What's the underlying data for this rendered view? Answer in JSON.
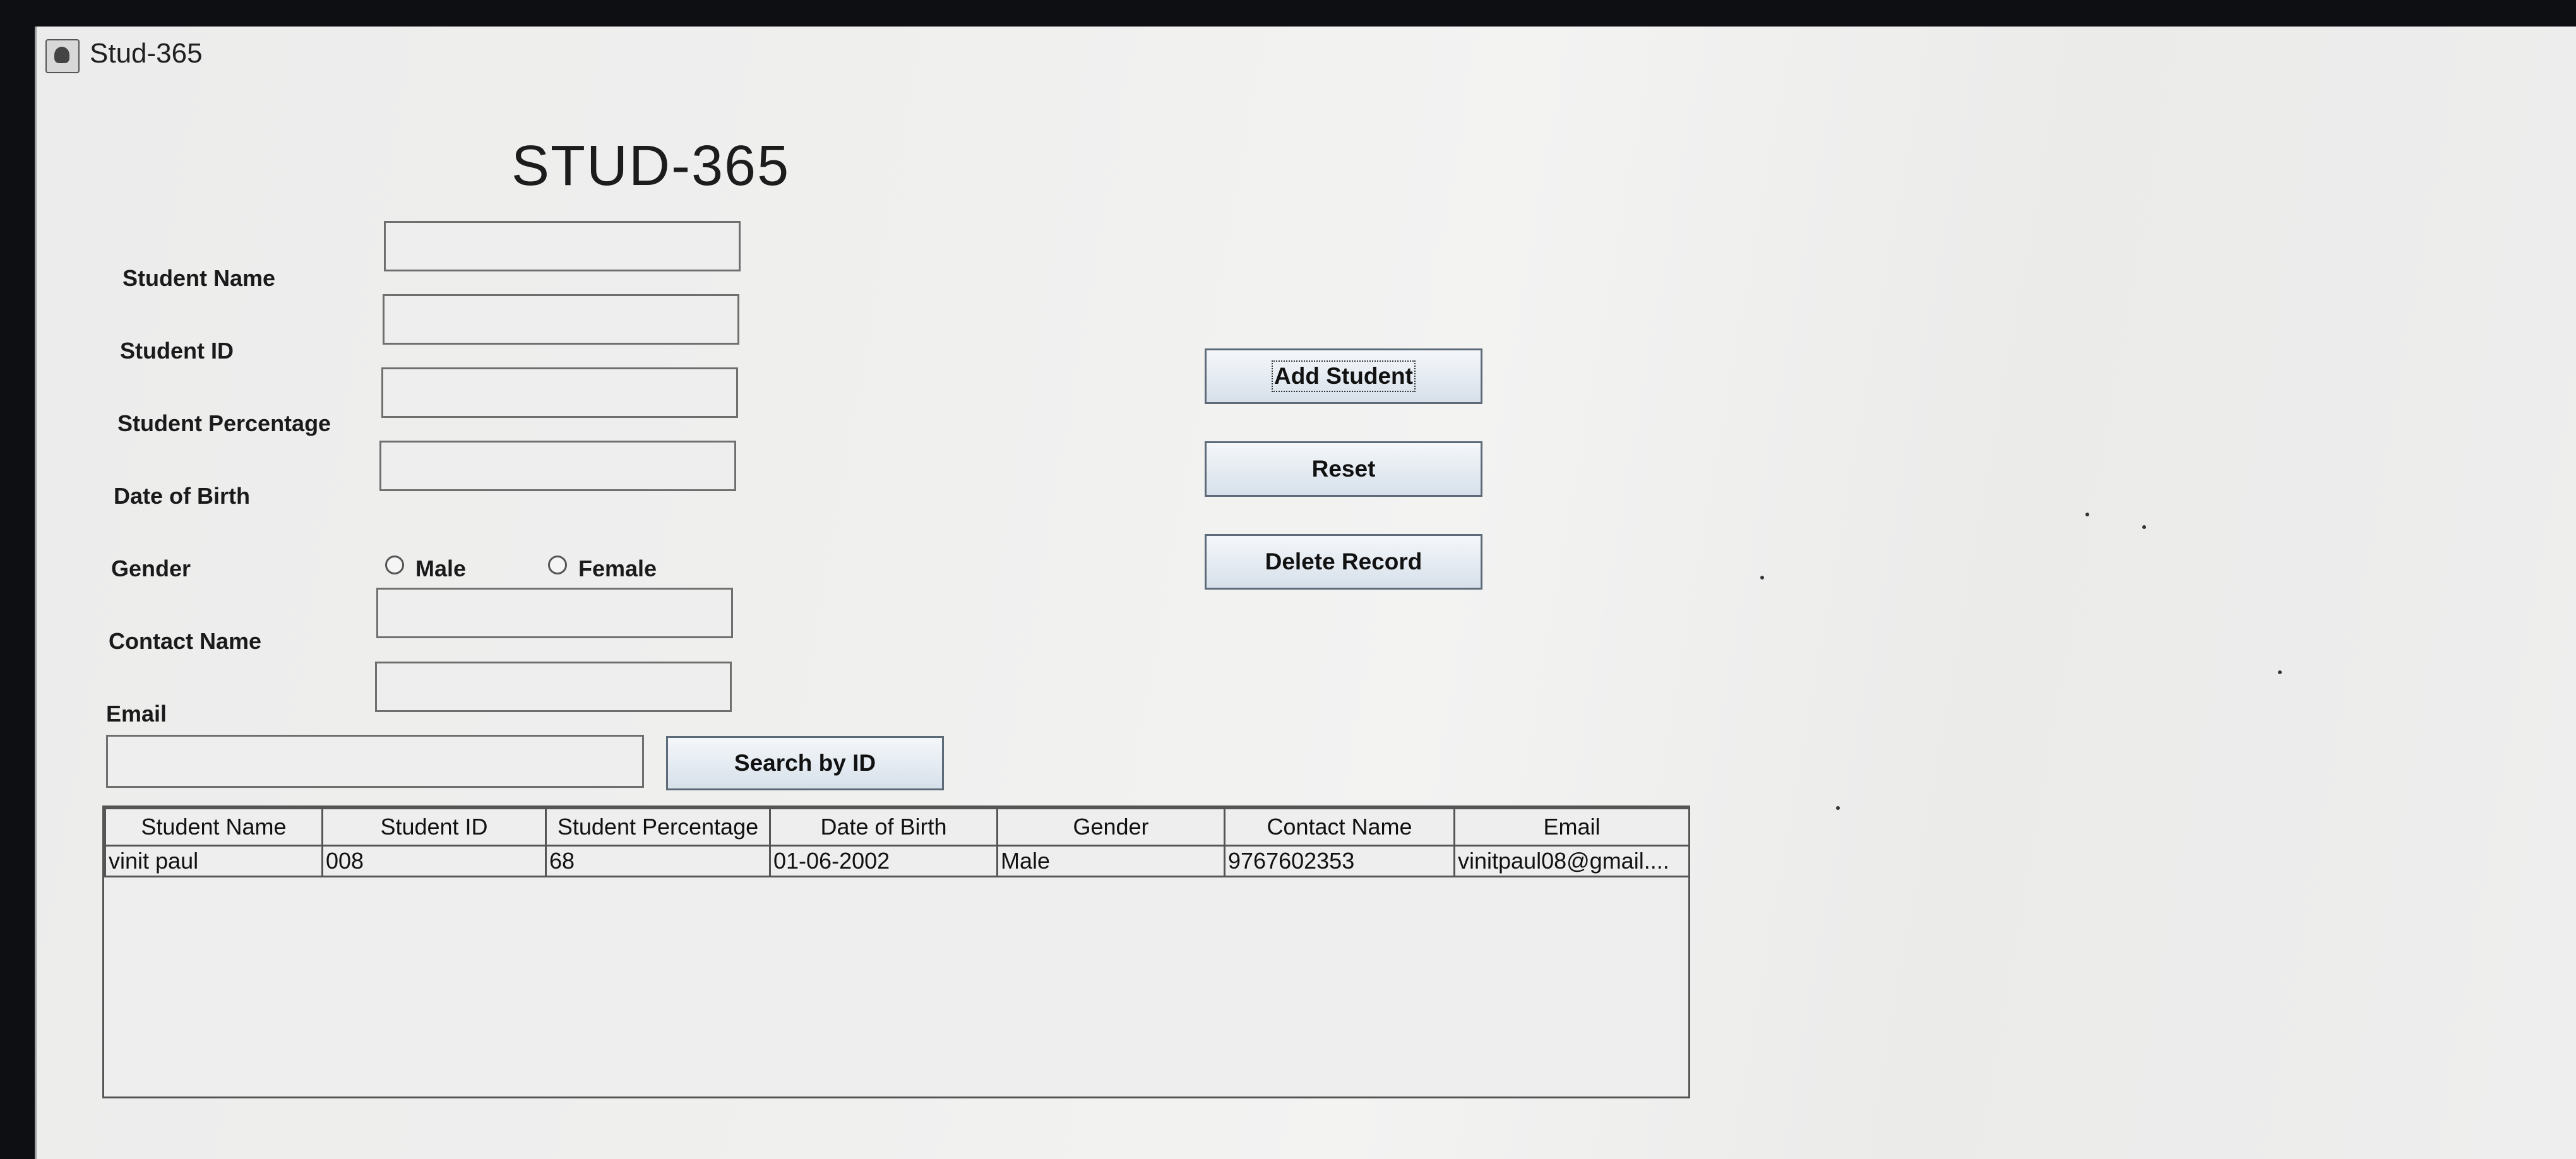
{
  "window": {
    "title": "Stud-365"
  },
  "app": {
    "heading": "STUD-365"
  },
  "form": {
    "student_name_label": "Student Name",
    "student_id_label": "Student ID",
    "student_percentage_label": "Student Percentage",
    "dob_label": "Date of Birth",
    "gender_label": "Gender",
    "gender_options": [
      "Male",
      "Female"
    ],
    "contact_name_label": "Contact Name",
    "email_label": "Email"
  },
  "buttons": {
    "add": "Add Student",
    "reset": "Reset",
    "delete": "Delete Record",
    "search": "Search by ID"
  },
  "table": {
    "columns": [
      "Student Name",
      "Student ID",
      "Student Percentage",
      "Date of Birth",
      "Gender",
      "Contact Name",
      "Email"
    ],
    "rows": [
      [
        "vinit paul",
        "008",
        "68",
        "01-06-2002",
        "Male",
        "9767602353",
        "vinitpaul08@gmail...."
      ]
    ]
  }
}
